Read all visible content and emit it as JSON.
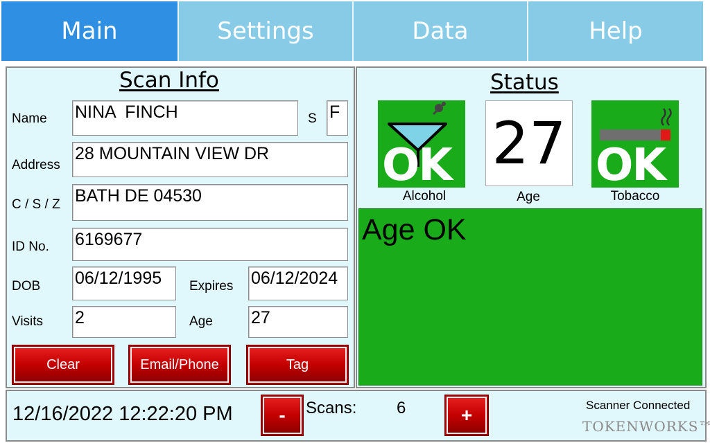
{
  "tabs": [
    {
      "label": "Main",
      "active": true
    },
    {
      "label": "Settings",
      "active": false
    },
    {
      "label": "Data",
      "active": false
    },
    {
      "label": "Help",
      "active": false
    }
  ],
  "scan_info": {
    "heading": "Scan Info",
    "name_label": "Name",
    "name_value": "NINA  FINCH",
    "sex_label": "S",
    "sex_value": "F",
    "address_label": "Address",
    "address_value": "28 MOUNTAIN VIEW DR",
    "csz_label": "C / S / Z",
    "csz_value": "BATH DE 04530",
    "id_label": "ID No.",
    "id_value": "6169677",
    "dob_label": "DOB",
    "dob_value": "06/12/1995",
    "expires_label": "Expires",
    "expires_value": "06/12/2024",
    "visits_label": "Visits",
    "visits_value": "2",
    "age_label": "Age",
    "age_value": "27",
    "clear_label": "Clear",
    "email_phone_label": "Email/Phone",
    "tag_label": "Tag"
  },
  "status": {
    "heading": "Status",
    "alcohol_text": "OK",
    "alcohol_label": "Alcohol",
    "age_value": "27",
    "age_label": "Age",
    "tobacco_text": "OK",
    "tobacco_label": "Tobacco",
    "message": "Age OK",
    "ok_color": "#1aab1a"
  },
  "bottom": {
    "datetime": "12/16/2022 12:22:20 PM",
    "minus_label": "-",
    "scans_label": "Scans:",
    "scans_count": "6",
    "plus_label": "+",
    "scanner_status": "Scanner Connected",
    "brand": "TOKENWORKS™"
  },
  "icons": [
    "martini-icon",
    "cigarette-icon"
  ]
}
